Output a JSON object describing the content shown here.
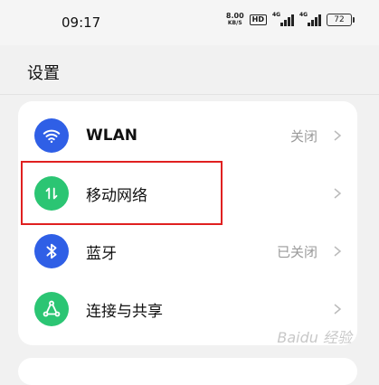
{
  "status_bar": {
    "time": "09:17",
    "net_speed": "8.00",
    "net_unit": "KB/S",
    "hd_badge": "HD",
    "signal_tag_1": "4G",
    "signal_tag_2": "4G",
    "battery": "72"
  },
  "page": {
    "title": "设置"
  },
  "settings": [
    {
      "label": "WLAN",
      "value": "关闭",
      "icon": "wifi-icon",
      "color": "#2f5fe6"
    },
    {
      "label": "移动网络",
      "value": "",
      "icon": "mobile-data-icon",
      "color": "#2bc573"
    },
    {
      "label": "蓝牙",
      "value": "已关闭",
      "icon": "bluetooth-icon",
      "color": "#2f5fe6"
    },
    {
      "label": "连接与共享",
      "value": "",
      "icon": "share-icon",
      "color": "#2bc573"
    }
  ],
  "watermark": "Baidu 经验",
  "highlight_color": "#e02020"
}
